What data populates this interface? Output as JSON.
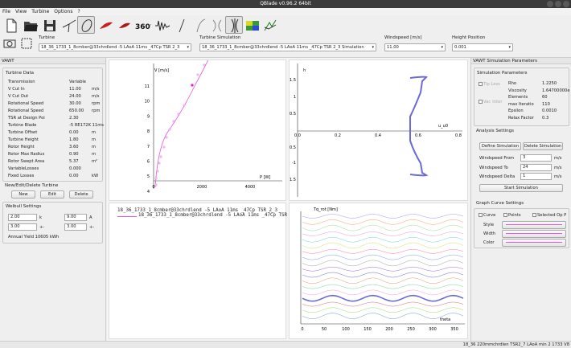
{
  "window": {
    "title": "QBlade v0.96.2 64bit"
  },
  "menu": [
    "File",
    "View",
    "Turbine",
    "Options",
    "?"
  ],
  "toolbar": {
    "tools": [
      "new-file-icon",
      "open-folder-icon",
      "save-icon",
      "airfoil-icon",
      "airfoil-design-icon",
      "blade-design-icon",
      "polar-icon",
      "360-extrapolation-icon",
      "turbulence-icon",
      "hawt-icon",
      "dms-icon",
      "vawt-icon",
      "wind-field-icon",
      "turbine-module-icon"
    ],
    "label_360": "360°"
  },
  "selectors": {
    "turbine_label": "Turbine",
    "turbine_value": "18_36_1733_1_8cmber@33chrdlend -5 LAoA 11ms _47Cp TSR 2_3",
    "simulation_label": "Turbine Simulation",
    "simulation_value": "18_36_1733_1_8cmber@33chrdlend -5 LAoA 11ms _47Cp TSR 2_3 Simulation",
    "windspeed_label": "Windspeed [m/s]",
    "windspeed_value": "11.00",
    "height_label": "Height Position",
    "height_value": "0.001"
  },
  "left_panel": {
    "title": "VAWT",
    "turbine_data_title": "Turbine Data",
    "rows": [
      {
        "label": "Transmission",
        "value": "Variable",
        "unit": ""
      },
      {
        "label": "V Cut In",
        "value": "11.00",
        "unit": "m/s"
      },
      {
        "label": "V Cut Out",
        "value": "24.00",
        "unit": "m/s"
      },
      {
        "label": "Rotational Speed",
        "value": "30.00",
        "unit": "rpm"
      },
      {
        "label": "Rotational Speed",
        "value": "650.00",
        "unit": "rpm"
      },
      {
        "label": "TSR at Design Poi",
        "value": "2.30",
        "unit": ""
      },
      {
        "label": "Turbine Blade",
        "value": "-5 RE172K 11ms",
        "unit": ""
      },
      {
        "label": "Turbine Offset",
        "value": "0.00",
        "unit": "m"
      },
      {
        "label": "Turbine Height",
        "value": "1.80",
        "unit": "m"
      },
      {
        "label": "Rotor Height",
        "value": "3.60",
        "unit": "m"
      },
      {
        "label": "Rotor Max Radius",
        "value": "0.90",
        "unit": "m"
      },
      {
        "label": "Rotor Swept Area",
        "value": "5.37",
        "unit": "m²"
      },
      {
        "label": "VariableLosses",
        "value": "0.000",
        "unit": ""
      },
      {
        "label": "Fixed Losses",
        "value": "0.00",
        "unit": "kW"
      }
    ],
    "ned_title": "New/Edit/Delete Turbine",
    "new_label": "New",
    "edit_label": "Edit",
    "delete_label": "Delete",
    "weibull_title": "Weibull Settings",
    "k_value": "2.00",
    "k_label": "k",
    "a_value": "9.00",
    "a_label": "A",
    "k_step": "3.00",
    "a_step": "3.00",
    "pm_label": "+-",
    "annual_yield": "Annual Yield  10605 kWh"
  },
  "graphs": {
    "top_left": {
      "ylabel": "V [m/s]",
      "xlabel": "P [W]",
      "yticks": [
        "11",
        "10",
        "9",
        "8",
        "7",
        "6",
        "5",
        "4"
      ],
      "xticks": [
        "0",
        "2000",
        "4000"
      ]
    },
    "top_right": {
      "ylabel": "h",
      "xlabel": "u_u0",
      "xticks": [
        "0.0",
        "0.2",
        "0.4",
        "0.6",
        "0.8"
      ],
      "yticks": [
        "1.5",
        "1",
        "0.5",
        "-0.5",
        "-1",
        "-1.5"
      ]
    },
    "legend": {
      "entry1": "18_36_1733_1_8cmber@33chrdlend -5 LAoA 11ms _47Cp TSR 2_3",
      "entry2": "18_36_1733_1_8cmber@33chrdlend -5 LAoA 11ms _47Cp TSR 2_3 Simulation"
    },
    "bottom_right": {
      "ylabel": "Tq_rot [Nm]",
      "xlabel": "theta",
      "xticks": [
        "0",
        "50",
        "100",
        "150",
        "200",
        "250",
        "300",
        "350"
      ]
    }
  },
  "right_panel": {
    "title": "VAWT Simulation Parameters",
    "sim_params_title": "Simulation Parameters",
    "tip_loss": "Tip Loss",
    "var_inter": "Var. Inter",
    "params": [
      {
        "label": "Rho",
        "value": "1.2250"
      },
      {
        "label": "Viscosity",
        "value": "1.64700000e"
      },
      {
        "label": "Elements",
        "value": "60"
      },
      {
        "label": "max Iteratio",
        "value": "110"
      },
      {
        "label": "Epsilon",
        "value": "0.0010"
      },
      {
        "label": "Relax Factor",
        "value": "0.3"
      }
    ],
    "analysis_title": "Analysis Settings",
    "define_sim": "Define Simulation",
    "delete_sim": "Delete Simulation",
    "ws_from_label": "Windspeed From",
    "ws_from": "3",
    "ws_to_label": "Windspeed To",
    "ws_to": "24",
    "ws_delta_label": "Windspeed Delta",
    "ws_delta": "1",
    "unit_ms": "m/s",
    "start_sim": "Start Simulation",
    "graph_curve_title": "Graph Curve Settings",
    "curve_label": "Curve",
    "points_label": "Points",
    "selected_label": "Selected Op P",
    "style_label": "Style",
    "width_label": "Width",
    "color_label": "Color"
  },
  "status": {
    "text": "18_36 220mmchrdlen TSR2_7 LAoA min 2 1733 V8"
  },
  "colors": {
    "curve": "#e55ad8",
    "series_blue": "#6a6ad8",
    "active_tool": "#e2e2e2"
  }
}
